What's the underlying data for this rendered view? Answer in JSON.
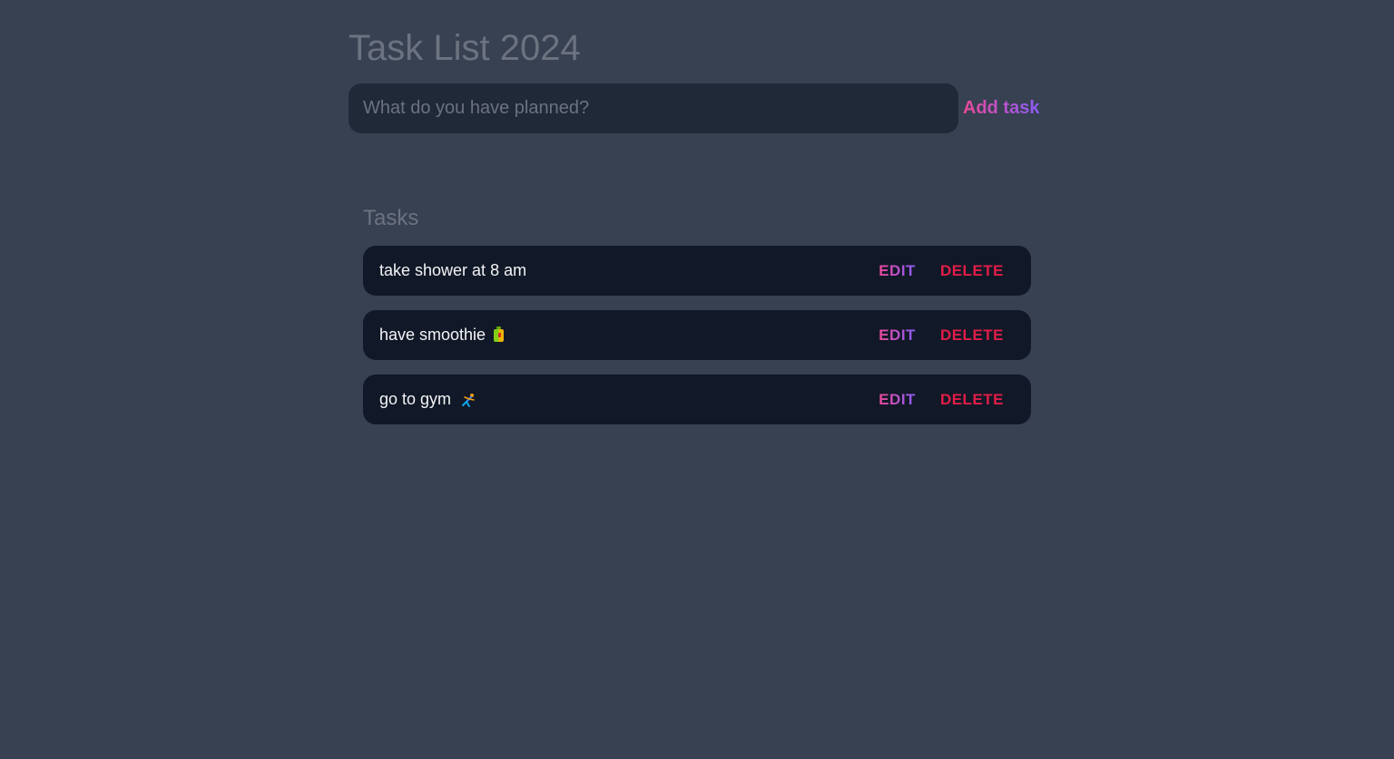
{
  "header": {
    "title": "Task List 2024"
  },
  "new_task_form": {
    "input_value": "",
    "input_placeholder": "What do you have planned?",
    "add_label": "Add task"
  },
  "tasks_section": {
    "heading": "Tasks",
    "items": [
      {
        "text": "take shower at 8 am",
        "emoji": "",
        "edit_label": "Edit",
        "delete_label": "Delete"
      },
      {
        "text": "have smoothie",
        "emoji": "beverage-box-icon",
        "edit_label": "Edit",
        "delete_label": "Delete"
      },
      {
        "text": "go to gym",
        "emoji": "person-cartwheeling-icon",
        "edit_label": "Edit",
        "delete_label": "Delete"
      }
    ]
  },
  "colors": {
    "background": "#374151",
    "input_background": "#1f2937",
    "task_background": "#111827",
    "muted_text": "#6b7280",
    "accent_gradient_start": "#ec4899",
    "accent_gradient_end": "#8b5cf6",
    "danger": "#e11d48"
  }
}
